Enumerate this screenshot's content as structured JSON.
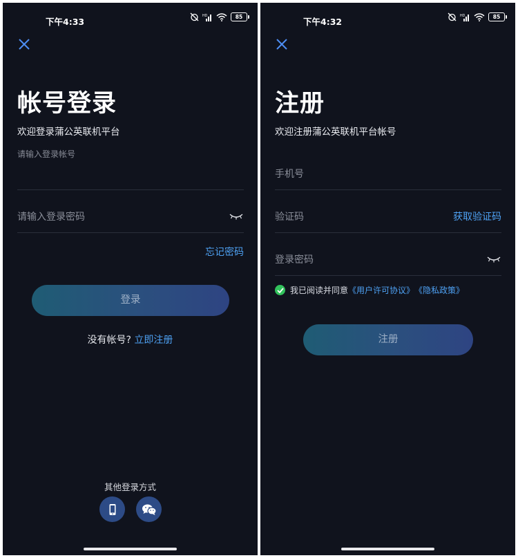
{
  "status_bar": {
    "left_time": "下午4:33",
    "right_time": "下午4:32",
    "battery": "85",
    "network_label": "HD"
  },
  "login": {
    "title": "帐号登录",
    "subtitle": "欢迎登录蒲公英联机平台",
    "account_placeholder": "请输入登录帐号",
    "password_placeholder": "请输入登录密码",
    "forgot_password": "忘记密码",
    "login_button": "登录",
    "no_account_text": "没有帐号?",
    "register_link": "立即注册",
    "other_methods": "其他登录方式"
  },
  "register": {
    "title": "注册",
    "subtitle": "欢迎注册蒲公英联机平台帐号",
    "phone_placeholder": "手机号",
    "code_placeholder": "验证码",
    "get_code": "获取验证码",
    "password_placeholder": "登录密码",
    "agree_prefix": "我已阅读并同意",
    "user_agreement": "《用户许可协议》",
    "privacy_policy": "《隐私政策》",
    "register_button": "注册"
  },
  "icons": {
    "close": "close-icon",
    "eye_closed": "eye-closed-icon",
    "phone": "phone-icon",
    "wechat": "wechat-icon",
    "check": "check-icon"
  },
  "colors": {
    "background": "#10131d",
    "accent_blue": "#4ea1f3",
    "button_gradient_start": "#1f5c74",
    "button_gradient_end": "#2e4482",
    "check_green": "#32c25c"
  }
}
